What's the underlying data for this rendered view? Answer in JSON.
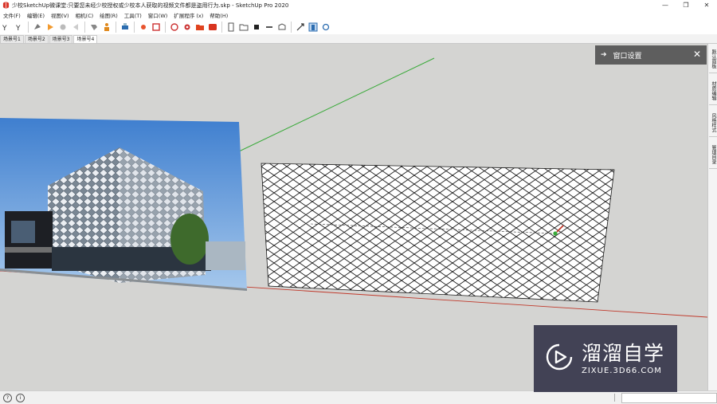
{
  "window": {
    "title": "少校SketchUp微课堂:只要您未经少校授权或少校本人获取的视频文件都是盗用行为.skp - SketchUp Pro 2020",
    "minimize_glyph": "—",
    "maximize_glyph": "❐",
    "close_glyph": "✕"
  },
  "menu": {
    "items": [
      "文件(F)",
      "编辑(E)",
      "视图(V)",
      "相机(C)",
      "绘图(R)",
      "工具(T)",
      "窗口(W)",
      "扩展程序 (x)",
      "帮助(H)"
    ]
  },
  "scenes": {
    "tabs": [
      "场景号1",
      "场景号2",
      "场景号3",
      "场景号4"
    ],
    "active_index": 3
  },
  "panel": {
    "title": "窗口设置",
    "arrow_glyph": "➔",
    "close_glyph": "✕"
  },
  "tray": {
    "tabs": [
      "默认面板",
      "材质编辑",
      "风格样式",
      "管理目录"
    ]
  },
  "status": {
    "hint_glyph": "?",
    "info_glyph": "i"
  },
  "watermark": {
    "title": "溜溜自学",
    "subtitle": "ZIXUE.3D66.COM"
  },
  "colors": {
    "viewport": "#d4d4d2",
    "axis_green": "#3aaa3a",
    "axis_red": "#c0392b",
    "panel_header": "#5e5e5e",
    "watermark_bg": "#282840"
  }
}
